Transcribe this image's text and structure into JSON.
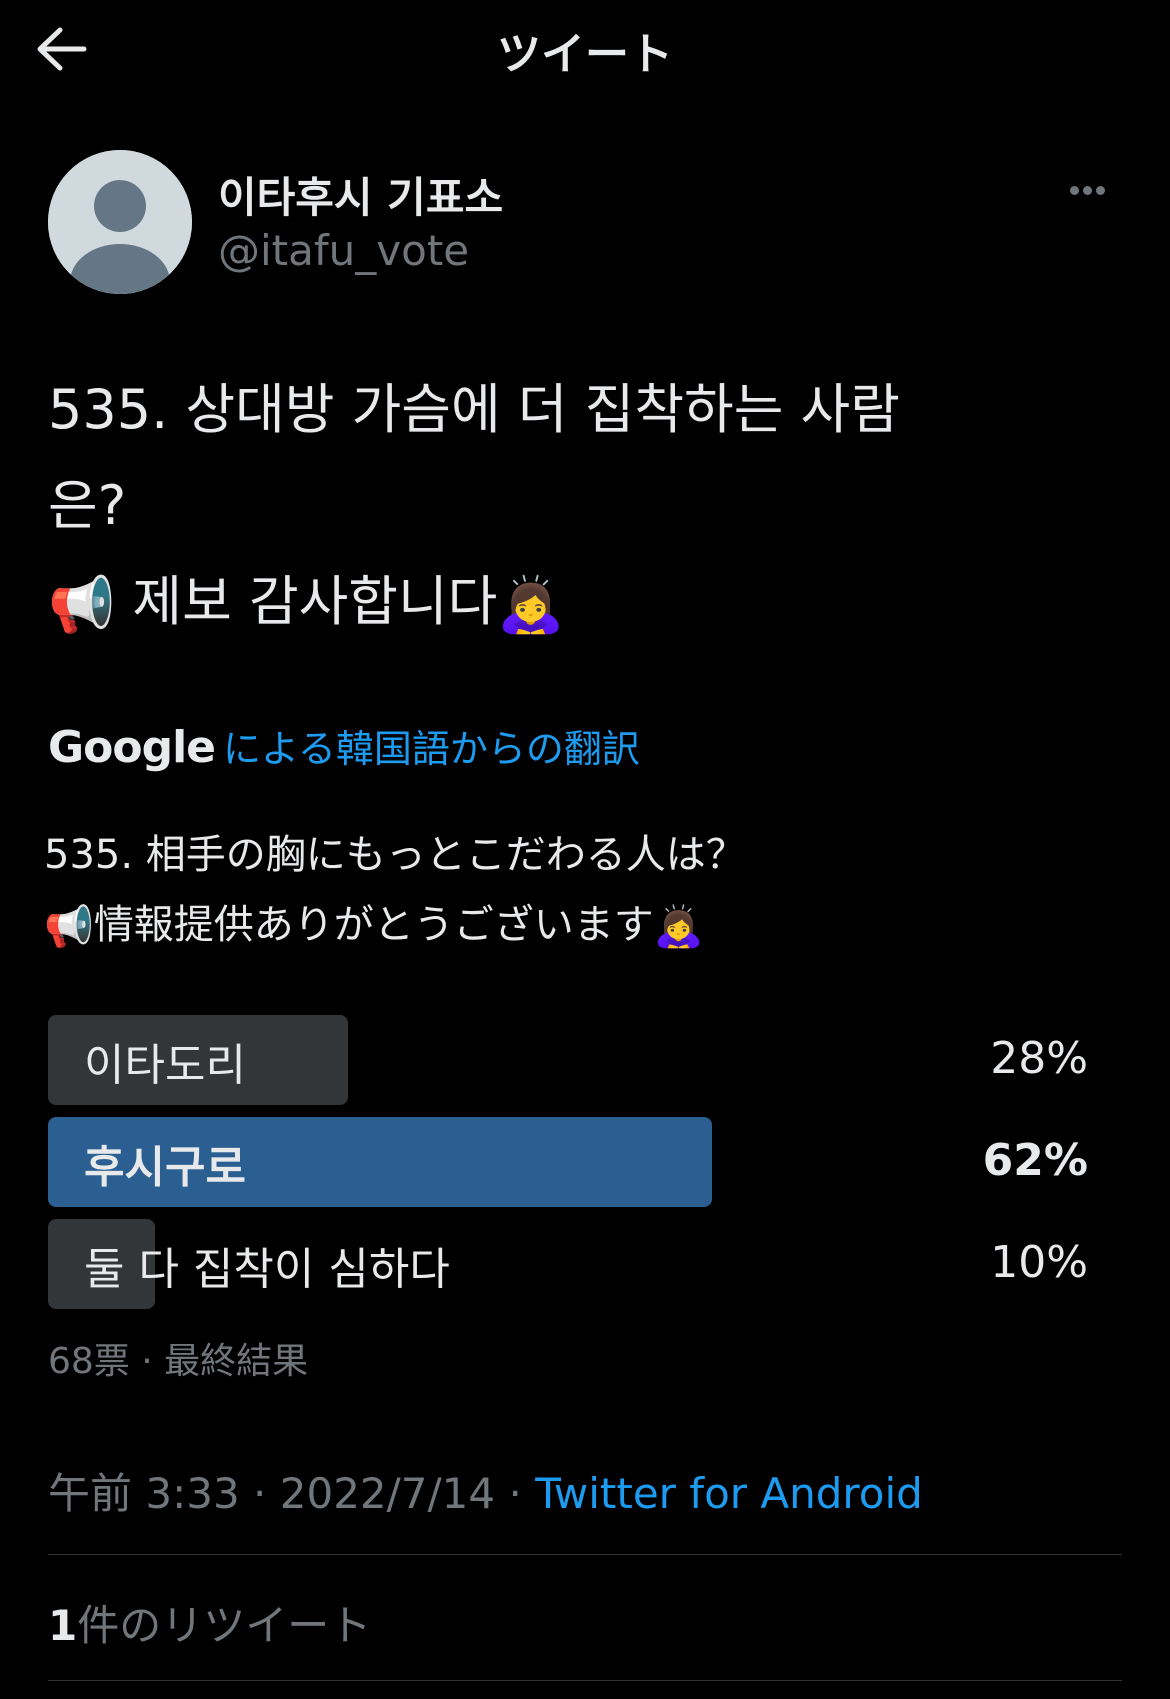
{
  "header": {
    "title": "ツイート",
    "back_icon": "arrow-left-icon"
  },
  "author": {
    "display_name": "이타후시 기표소",
    "handle": "@itafu_vote",
    "avatar_icon": "default-avatar-icon",
    "more_icon": "more-dots-icon"
  },
  "tweet": {
    "line1": "535. 상대방 가슴에 더 집착하는 사람",
    "line2": "은?",
    "line3": "제보 감사합니다",
    "emoji_megaphone": "📢",
    "emoji_bow": "🙇‍♀️"
  },
  "translation": {
    "provider": "Google",
    "label": "による韓国語からの翻訳",
    "line1": "535. 相手の胸にもっとこだわる人は？",
    "line2": "情報提供ありがとうございます"
  },
  "poll": {
    "options": [
      {
        "label": "이타도리",
        "percent_text": "28%",
        "share": 0.28,
        "winner": false
      },
      {
        "label": "후시구로",
        "percent_text": "62%",
        "share": 0.62,
        "winner": true
      },
      {
        "label": "둘 다 집착이 심하다",
        "percent_text": "10%",
        "share": 0.1,
        "winner": false
      }
    ],
    "meta": "68票 · 最終結果"
  },
  "meta": {
    "time": "午前 3:33",
    "date": "2022/7/14",
    "separator": "·",
    "source": "Twitter for Android"
  },
  "retweets": {
    "count": "1",
    "label": "件のリツイート"
  },
  "colors": {
    "accent": "#1d9bf0",
    "poll_winner": "#2b5f91",
    "poll_bar": "#333639",
    "muted": "#71767b"
  }
}
